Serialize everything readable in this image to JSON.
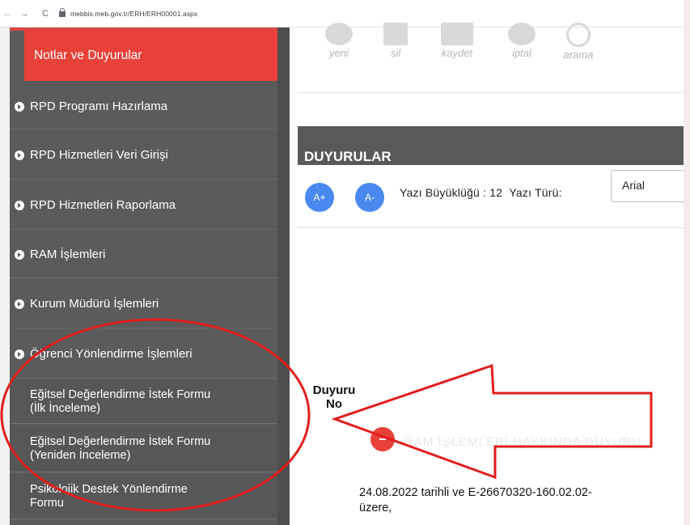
{
  "browser": {
    "back_glyph": "←",
    "forward_glyph": "→",
    "reload_glyph": "C",
    "url": "mebbis.meb.gov.tr/ERH/ERH00001.aspx"
  },
  "sidebar": {
    "active_header": "Notlar ve Duyurular",
    "items": [
      {
        "label": "RPD Programı Hazırlama"
      },
      {
        "label": "RPD Hizmetleri Veri Girişi"
      },
      {
        "label": "RPD Hizmetleri Raporlama"
      },
      {
        "label": "RAM İşlemleri"
      },
      {
        "label": "Kurum Müdürü İşlemleri"
      },
      {
        "label": "Öğrenci Yönlendirme İşlemleri"
      }
    ],
    "sub_items": [
      {
        "line1": "Eğitsel Değerlendirme İstek Formu",
        "line2": "(İlk İnceleme)"
      },
      {
        "line1": "Eğitsel Değerlendirme İstek Formu",
        "line2": "(Yeniden İnceleme)"
      },
      {
        "line1": "Psikolojik Destek Yönlendirme",
        "line2": "Formu"
      }
    ]
  },
  "toolbar": {
    "yeni": "yeni",
    "sil": "sil",
    "kaydet": "kaydet",
    "iptal": "iptal",
    "arama": "arama"
  },
  "panel": {
    "title": "DUYURULAR",
    "increase_label": "A+",
    "decrease_label": "A-",
    "font_size_text": "Yazı Büyüklüğü : 12",
    "font_type_text": "Yazı Türü:",
    "font_type_value": "Arial"
  },
  "table": {
    "column_header_line1": "Duyuru",
    "column_header_line2": "No",
    "faded_heading": "RAM İŞLEMLERİ HAKKINDA DUYURU",
    "body_line1": "24.08.2022  tarihli ve  E-26670320-160.02.02-",
    "body_line2": "üzere,"
  },
  "colors": {
    "accent_red": "#e8413a",
    "sidebar_bg": "#5b5b5b",
    "button_blue": "#4a89ef",
    "annotation_red": "#e21d1d"
  }
}
